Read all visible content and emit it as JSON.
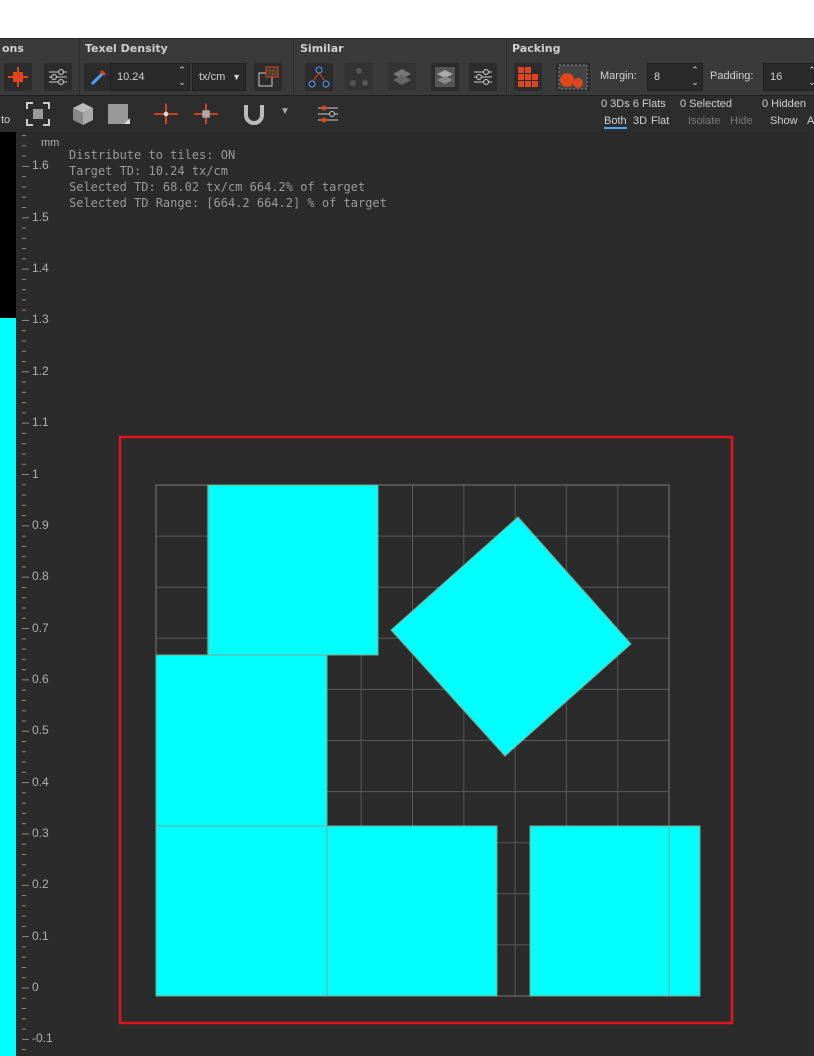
{
  "toolbar": {
    "groups": {
      "options_title": "ons",
      "texel_title": "Texel Density",
      "similar_title": "Similar",
      "packing_title": "Packing"
    },
    "texel_value": "10.24",
    "texel_unit": "tx/cm",
    "margin_label": "Margin:",
    "margin_value": "8",
    "padding_label": "Padding:",
    "padding_value": "16"
  },
  "toolbar2": {
    "left_label": "to",
    "counts": "0 3Ds 6 Flats",
    "selected": "0 Selected",
    "hidden": "0 Hidden",
    "both": "Both",
    "three_d": "3D",
    "flat": "Flat",
    "isolate": "Isolate",
    "hide": "Hide",
    "show": "Show",
    "a": "A"
  },
  "viewport": {
    "unit": "mm",
    "info_lines": [
      "Distribute to tiles: ON",
      "Target TD: 10.24 tx/cm",
      "Selected TD: 68.02 tx/cm 664.2% of target",
      "Selected TD Range: [664.2  664.2] % of target"
    ],
    "axis_labels": [
      "1.6",
      "1.5",
      "1.4",
      "1.3",
      "1.2",
      "1.1",
      "1",
      "0.9",
      "0.8",
      "0.7",
      "0.6",
      "0.5",
      "0.4",
      "0.3",
      "0.2",
      "0.1",
      "0",
      "-0.1"
    ],
    "uv_fill": "#00ffff",
    "selection_color": "#e0141b"
  },
  "colors": {
    "accent": "#e0461b",
    "toolbar_bg": "#3a3a3a",
    "viewport_bg": "#2b2b2b"
  }
}
